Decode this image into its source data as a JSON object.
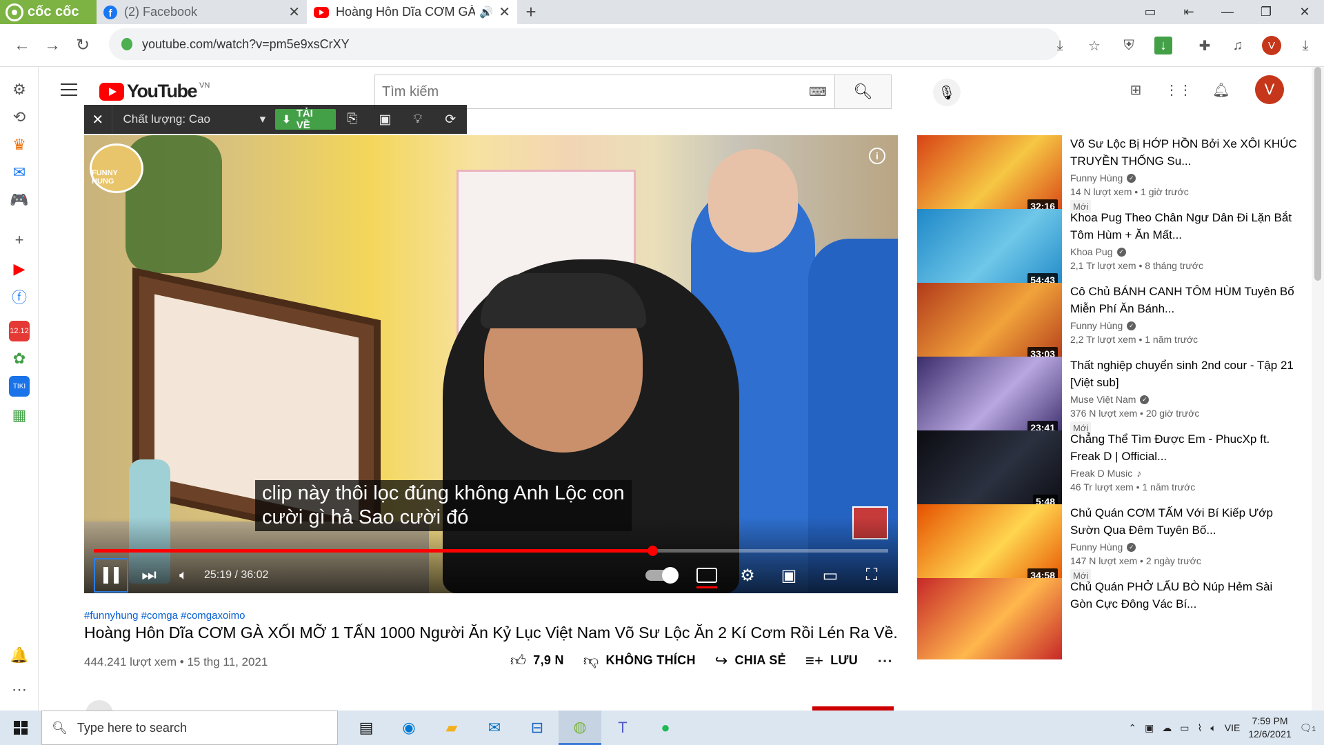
{
  "browser": {
    "brand": "cốc cốc",
    "tabs": [
      {
        "title": "(2) Facebook",
        "icon": "facebook-icon"
      },
      {
        "title": "Hoàng Hôn Dĩa CƠM GÀ",
        "icon": "youtube-icon"
      }
    ],
    "url": "youtube.com/watch?v=pm5e9xsCrXY",
    "profile_initial": "V"
  },
  "youtube": {
    "logo": "YouTube",
    "region": "VN",
    "search_placeholder": "Tìm kiếm",
    "avatar_initial": "V"
  },
  "coccoc_toolbar": {
    "quality_label": "Chất lượng: Cao",
    "download_label": "TẢI VỀ"
  },
  "player": {
    "channel_watermark": "FUNNY HUNG",
    "caption_line1": "clip này thôi lọc đúng không Anh Lộc con",
    "caption_line2": "cười gì hả Sao cười đó",
    "time": "25:19 / 36:02",
    "progress_fraction": 0.703,
    "is_playing": true
  },
  "video": {
    "hashtags": "#funnyhung #comga #comgaxoimo",
    "title": "Hoàng Hôn Dĩa CƠM GÀ XỐI MỠ 1 TẤN 1000 Người Ăn Kỷ Lục Việt Nam Võ Sư Lộc Ăn 2 Kí Cơm Rồi Lén Ra Về.",
    "views_date": "444.241 lượt xem • 15 thg 11, 2021",
    "like_count": "7,9 N",
    "dislike_label": "KHÔNG THÍCH",
    "share_label": "CHIA SẺ",
    "save_label": "LƯU"
  },
  "recommendations": [
    {
      "title": "Võ Sư Lộc Bị HỚP HỒN Bởi Xe XÔI KHÚC TRUYỀN THỐNG Su...",
      "channel": "Funny Hùng",
      "verified": true,
      "meta": "14 N lượt xem • 1 giờ trước",
      "badge": "Mới",
      "duration": "32:16",
      "color1": "#d84315",
      "color2": "#f6c744"
    },
    {
      "title": "Khoa Pug Theo Chân Ngư Dân Đi Lặn Bắt Tôm Hùm + Ăn Mất...",
      "channel": "Khoa Pug",
      "verified": true,
      "meta": "2,1 Tr lượt xem • 8 tháng trước",
      "badge": "",
      "duration": "54:43",
      "color1": "#1e88c8",
      "color2": "#6fc7e8"
    },
    {
      "title": "Cô Chủ BÁNH CANH TÔM HÙM Tuyên Bố Miễn Phí Ăn Bánh...",
      "channel": "Funny Hùng",
      "verified": true,
      "meta": "2,2 Tr lượt xem • 1 năm trước",
      "badge": "",
      "duration": "33:03",
      "color1": "#b23a1a",
      "color2": "#f1a33b"
    },
    {
      "title": "Thất nghiệp chuyển sinh 2nd cour - Tập 21 [Việt sub]",
      "channel": "Muse Việt Nam",
      "verified": true,
      "meta": "376 N lượt xem • 20 giờ trước",
      "badge": "Mới",
      "duration": "23:41",
      "color1": "#3b2d6b",
      "color2": "#b8a7e0"
    },
    {
      "title": "Chẳng Thể Tìm Được Em - PhucXp ft. Freak D | Official...",
      "channel": "Freak D Music",
      "verified": false,
      "meta": "46 Tr lượt xem • 1 năm trước",
      "badge": "",
      "duration": "5:48",
      "color1": "#0c0c12",
      "color2": "#2b3140"
    },
    {
      "title": "Chủ Quán CƠM TẤM Với Bí Kiếp Ướp Sườn Qua Đêm Tuyên Bố...",
      "channel": "Funny Hùng",
      "verified": true,
      "meta": "147 N lượt xem • 2 ngày trước",
      "badge": "Mới",
      "duration": "34:58",
      "color1": "#e65100",
      "color2": "#ffd54f"
    },
    {
      "title": "Chủ Quán PHỞ LẨU BÒ Núp Hẻm Sài Gòn Cực Đông Vác Bí...",
      "channel": "",
      "verified": false,
      "meta": "",
      "badge": "",
      "duration": "",
      "color1": "#c62828",
      "color2": "#ffb74d"
    }
  ],
  "taskbar": {
    "search_placeholder": "Type here to search",
    "language": "VIE",
    "time": "7:59 PM",
    "date": "12/6/2021",
    "notification_count": "1"
  }
}
